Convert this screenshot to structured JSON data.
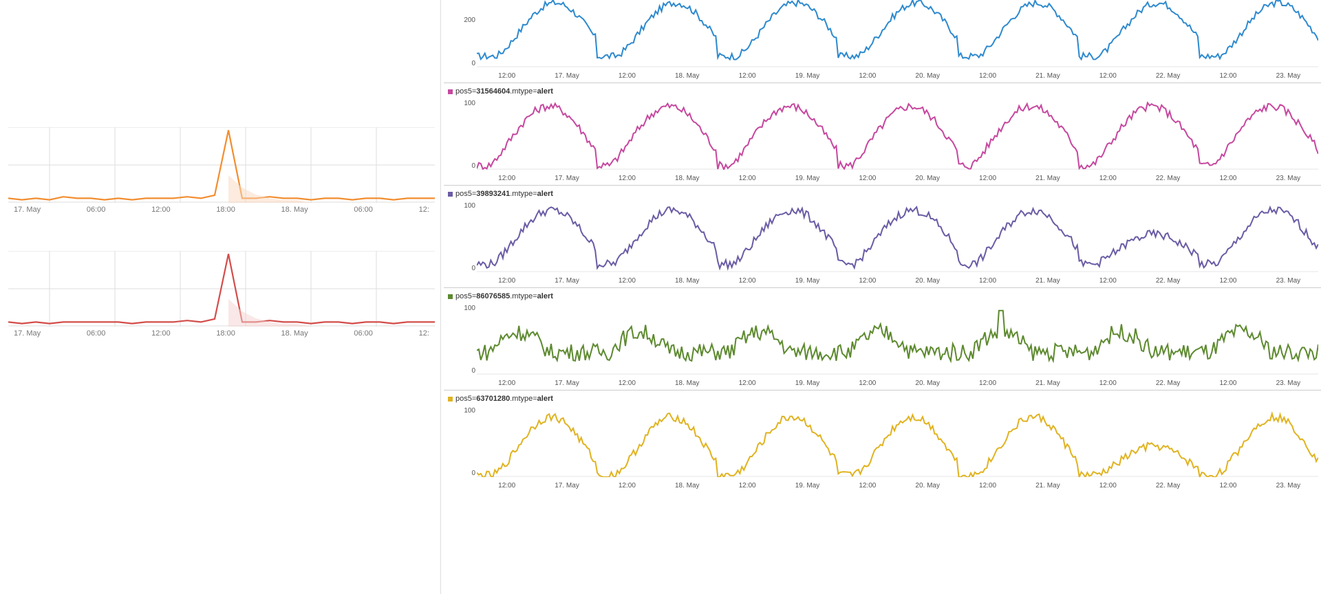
{
  "left": {
    "xticks": [
      "17. May",
      "06:00",
      "12:00",
      "18:00",
      "18. May",
      "06:00",
      "12:"
    ],
    "charts": [
      {
        "color": "#f28d2f",
        "fill": "#f9d8bd"
      },
      {
        "color": "#d34c49",
        "fill": "#f3d1d0"
      }
    ]
  },
  "right": {
    "xticks": [
      "12:00",
      "17. May",
      "12:00",
      "18. May",
      "12:00",
      "19. May",
      "12:00",
      "20. May",
      "12:00",
      "21. May",
      "12:00",
      "22. May",
      "12:00",
      "23. May"
    ],
    "panels": [
      {
        "legend": null,
        "color": "#2e8ace",
        "ymax": 200,
        "yticks": [
          "200",
          "0"
        ],
        "pos5": ""
      },
      {
        "legend": true,
        "color": "#c6489f",
        "ymax": 100,
        "yticks": [
          "100",
          "0"
        ],
        "pos5": "31564604"
      },
      {
        "legend": true,
        "color": "#6b5ca5",
        "ymax": 100,
        "yticks": [
          "100",
          "0"
        ],
        "pos5": "39893241"
      },
      {
        "legend": true,
        "color": "#5d8a2f",
        "ymax": 100,
        "yticks": [
          "100",
          "0"
        ],
        "pos5": "86076585"
      },
      {
        "legend": true,
        "color": "#e0b321",
        "ymax": 100,
        "yticks": [
          "100",
          "0"
        ],
        "pos5": "63701280"
      }
    ],
    "legend_mtype": "alert",
    "legend_prefix": "pos5=",
    "legend_mid": ".mtype="
  },
  "chart_data": [
    {
      "type": "line",
      "title": "",
      "xlabel": "",
      "ylabel": "",
      "x_categories": [
        "17. May",
        "06:00",
        "12:00",
        "18:00",
        "18. May",
        "06:00",
        "12:00"
      ],
      "series": [
        {
          "name": "orange-spike",
          "color": "#f28d2f",
          "values": [
            3,
            2,
            3,
            2,
            4,
            3,
            3,
            2,
            3,
            2,
            3,
            3,
            3,
            4,
            3,
            5,
            48,
            3,
            3,
            4,
            3,
            3,
            2,
            3,
            3,
            2,
            3,
            3,
            2,
            3,
            3,
            3
          ]
        }
      ],
      "ylim": [
        0,
        50
      ]
    },
    {
      "type": "line",
      "title": "",
      "xlabel": "",
      "ylabel": "",
      "x_categories": [
        "17. May",
        "06:00",
        "12:00",
        "18:00",
        "18. May",
        "06:00",
        "12:00"
      ],
      "series": [
        {
          "name": "red-spike",
          "color": "#d34c49",
          "values": [
            3,
            2,
            3,
            2,
            3,
            3,
            3,
            3,
            3,
            2,
            3,
            3,
            3,
            4,
            3,
            5,
            48,
            3,
            3,
            4,
            3,
            3,
            2,
            3,
            3,
            2,
            3,
            3,
            2,
            3,
            3,
            3
          ]
        }
      ],
      "ylim": [
        0,
        50
      ]
    },
    {
      "type": "line",
      "title": "",
      "xlabel": "",
      "ylabel": "",
      "x_range": [
        "16. May 12:00",
        "23. May 12:00"
      ],
      "series": [
        {
          "name": "blue-daily",
          "color": "#2e8ace",
          "pattern": "7 daily cycles, trough≈20 valley≈100 peak≈230"
        }
      ],
      "ylim": [
        0,
        220
      ]
    },
    {
      "type": "line",
      "title": "pos5=31564604.mtype=alert",
      "series": [
        {
          "name": "magenta-daily",
          "color": "#c6489f",
          "pattern": "7 daily cycles, trough≈8 peak≈120"
        }
      ],
      "ylim": [
        0,
        120
      ]
    },
    {
      "type": "line",
      "title": "pos5=39893241.mtype=alert",
      "series": [
        {
          "name": "purple-daily",
          "color": "#6b5ca5",
          "pattern": "7 daily cycles, trough≈15 peak≈115, day6 muted≈60"
        }
      ],
      "ylim": [
        0,
        120
      ]
    },
    {
      "type": "line",
      "title": "pos5=86076585.mtype=alert",
      "series": [
        {
          "name": "green-noisy",
          "color": "#5d8a2f",
          "pattern": "noisy 30–95 with weak daily periodicity, spike≈130 on 20. May"
        }
      ],
      "ylim": [
        0,
        130
      ]
    },
    {
      "type": "line",
      "title": "pos5=63701280.mtype=alert",
      "series": [
        {
          "name": "yellow-daily",
          "color": "#e0b321",
          "pattern": "7 daily cycles, trough≈2 peak≈105, day6 muted"
        }
      ],
      "ylim": [
        0,
        110
      ]
    }
  ]
}
